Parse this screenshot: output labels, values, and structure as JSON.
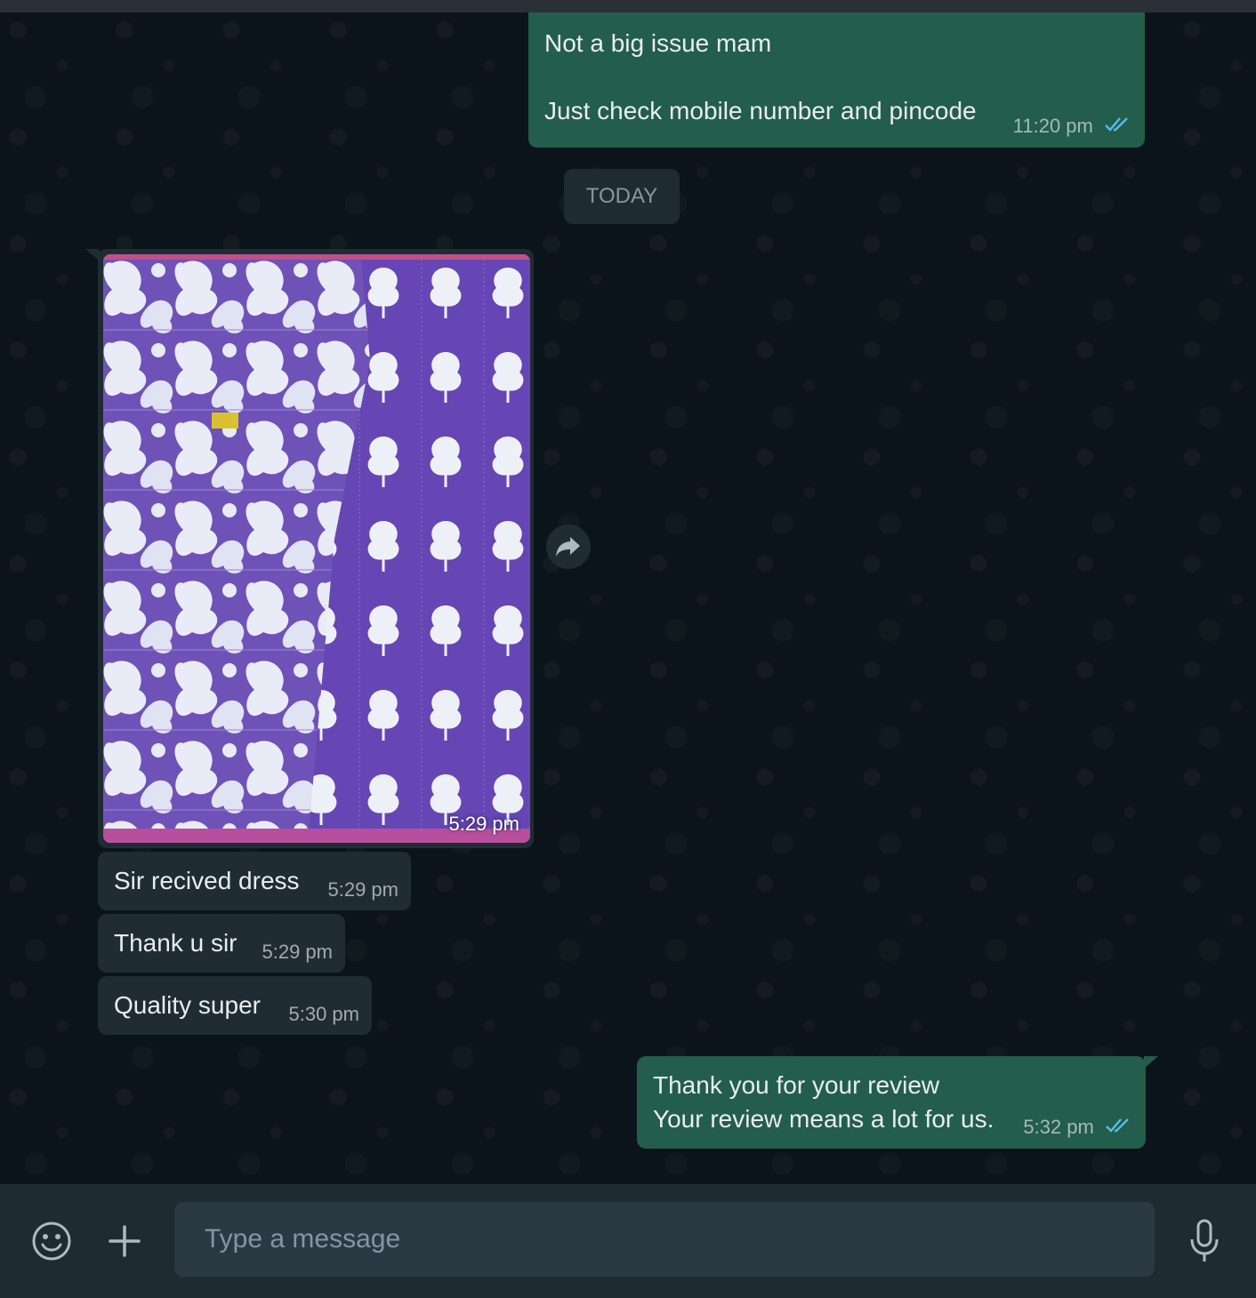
{
  "messages": {
    "out1": {
      "line1": "Not a big issue mam",
      "line2": "Just check mobile number and pincode",
      "time": "11:20 pm",
      "status": "read"
    },
    "date_divider": "TODAY",
    "image_msg": {
      "time": "5:29 pm"
    },
    "in1": {
      "text": "Sir recived dress",
      "time": "5:29 pm"
    },
    "in2": {
      "text": "Thank u sir",
      "time": "5:29 pm"
    },
    "in3": {
      "text": "Quality super",
      "time": "5:30 pm"
    },
    "out2": {
      "line1": "Thank you for your review",
      "line2": "Your review means a lot for us.",
      "time": "5:32 pm",
      "status": "read"
    }
  },
  "composer": {
    "placeholder": "Type a message",
    "icons": {
      "emoji": "emoji-icon",
      "attach": "plus-icon",
      "voice": "microphone-icon"
    }
  },
  "colors": {
    "background": "#0b141a",
    "outgoing_bubble": "#235d4b",
    "incoming_bubble": "#1f2c33",
    "read_ticks": "#53bdeb",
    "composer": "#1f2b32"
  }
}
